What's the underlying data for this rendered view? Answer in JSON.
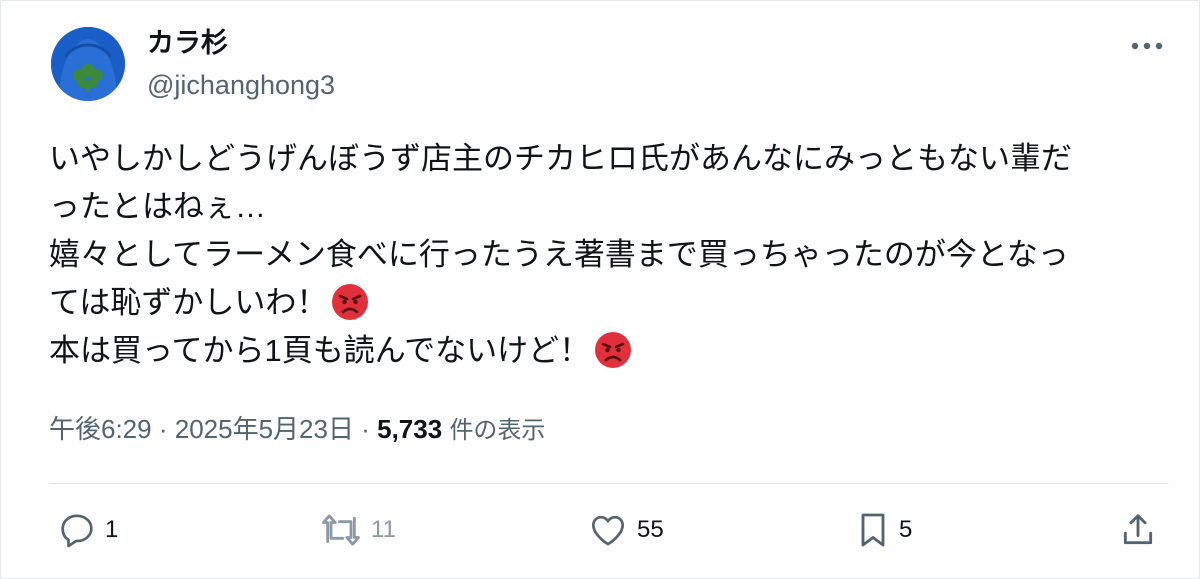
{
  "author": {
    "name": "カラ杉",
    "handle": "@jichanghong3"
  },
  "tweet": {
    "lines": [
      "いやしかしどうげんぼうず店主のチカヒロ氏があんなにみっともない輩だ",
      "ったとはねぇ…",
      "嬉々としてラーメン食べに行ったうえ著書まで買っちゃったのが今となっ",
      "ては恥ずかしいわ！",
      "本は買ってから1頁も読んでないけど！"
    ],
    "emoji": "angry-face"
  },
  "meta": {
    "time": "午後6:29",
    "separator": "·",
    "date": "2025年5月23日",
    "views_count": "5,733",
    "views_label": "件の表示"
  },
  "actions": {
    "replies": "1",
    "retweets": "11",
    "likes": "55",
    "bookmarks": "5"
  },
  "colors": {
    "text": "#0f1419",
    "secondary": "#536471",
    "border": "#e6e9ec",
    "avatar_bg": "#1a5fc8",
    "emoji_red": "#e0303c"
  }
}
